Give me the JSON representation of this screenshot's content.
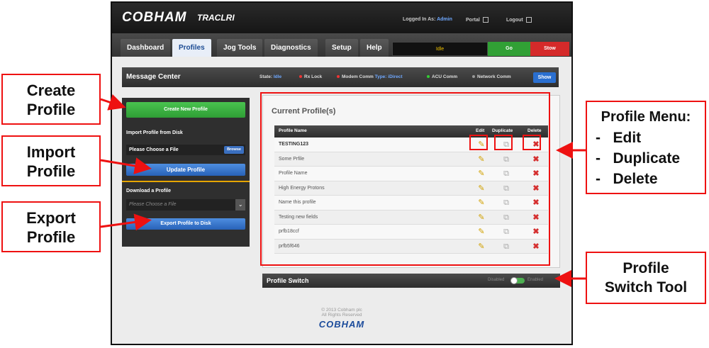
{
  "header": {
    "logo": "COBHAM",
    "logo_sub": "TRACLRI",
    "logged_in_label": "Logged In As:",
    "user": "Admin",
    "portal": "Portal",
    "logout": "Logout"
  },
  "nav": {
    "tabs": [
      "Dashboard",
      "Profiles",
      "Jog Tools",
      "Diagnostics",
      "Setup",
      "Help"
    ],
    "active": "Profiles",
    "status": "Idle",
    "go": "Go",
    "stow": "Stow"
  },
  "message_center": {
    "title": "Message Center",
    "state_label": "State:",
    "state_value": "Idle",
    "rx_lock": "Rx Lock",
    "modem_comm": "Modem Comm",
    "modem_type_label": "Type:",
    "modem_type_value": "iDirect",
    "acu_comm": "ACU Comm",
    "network_comm": "Network Comm",
    "show": "Show"
  },
  "left_panel": {
    "create_button": "Create New Profile",
    "import_label": "Import Profile from Disk",
    "file_placeholder": "Please Choose a File",
    "browse": "Browse",
    "update_button": "Update Profile",
    "download_label": "Download a Profile",
    "select_placeholder": "Please Choose a File",
    "export_button": "Export Profile to Disk"
  },
  "profiles": {
    "title": "Current Profile(s)",
    "columns": {
      "name": "Profile Name",
      "edit": "Edit",
      "duplicate": "Duplicate",
      "delete": "Delete"
    },
    "rows": [
      "TESTING123",
      "Some Prfile",
      "Profile Name",
      "High Energy Protons",
      "Name this profile",
      "Testing new fields",
      "prfb18ccf",
      "prfb5f646"
    ]
  },
  "profile_switch": {
    "title": "Profile Switch",
    "disabled": "Disabled",
    "enabled": "Enabled"
  },
  "footer": {
    "copyright": "© 2013 Cobham plc",
    "rights": "All Rights Reserved",
    "logo": "COBHAM"
  },
  "annotations": {
    "create": [
      "Create",
      "Profile"
    ],
    "import": [
      "Import",
      "Profile"
    ],
    "export": [
      "Export",
      "Profile"
    ],
    "menu_title": "Profile Menu:",
    "menu_items": [
      "Edit",
      "Duplicate",
      "Delete"
    ],
    "switch": [
      "Profile",
      "Switch Tool"
    ]
  },
  "colors": {
    "annotation_red": "#e11111",
    "brand_blue": "#1b4b9b",
    "go_green": "#31a035",
    "stow_red": "#d52a2a"
  }
}
